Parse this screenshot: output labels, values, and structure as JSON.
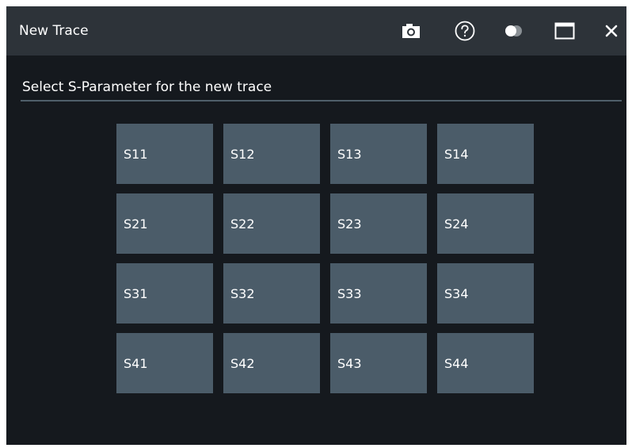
{
  "window": {
    "title": "New Trace",
    "buttons": [
      {
        "name": "camera-icon",
        "glyph": "screenshot"
      },
      {
        "name": "help-icon",
        "glyph": "?"
      },
      {
        "name": "toggle-icon",
        "glyph": "transparency"
      },
      {
        "name": "maximize-icon",
        "glyph": "maximize"
      },
      {
        "name": "close-icon",
        "glyph": "✕"
      }
    ]
  },
  "prompt": "Select S-Parameter for the new trace",
  "sparams": [
    [
      "S11",
      "S12",
      "S13",
      "S14"
    ],
    [
      "S21",
      "S22",
      "S23",
      "S24"
    ],
    [
      "S31",
      "S32",
      "S33",
      "S34"
    ],
    [
      "S41",
      "S42",
      "S43",
      "S44"
    ]
  ],
  "colors": {
    "background": "#15191e",
    "titlebar": "#2d3339",
    "button": "#4b5c69",
    "divider": "#4f5f6a",
    "text": "#ffffff"
  }
}
